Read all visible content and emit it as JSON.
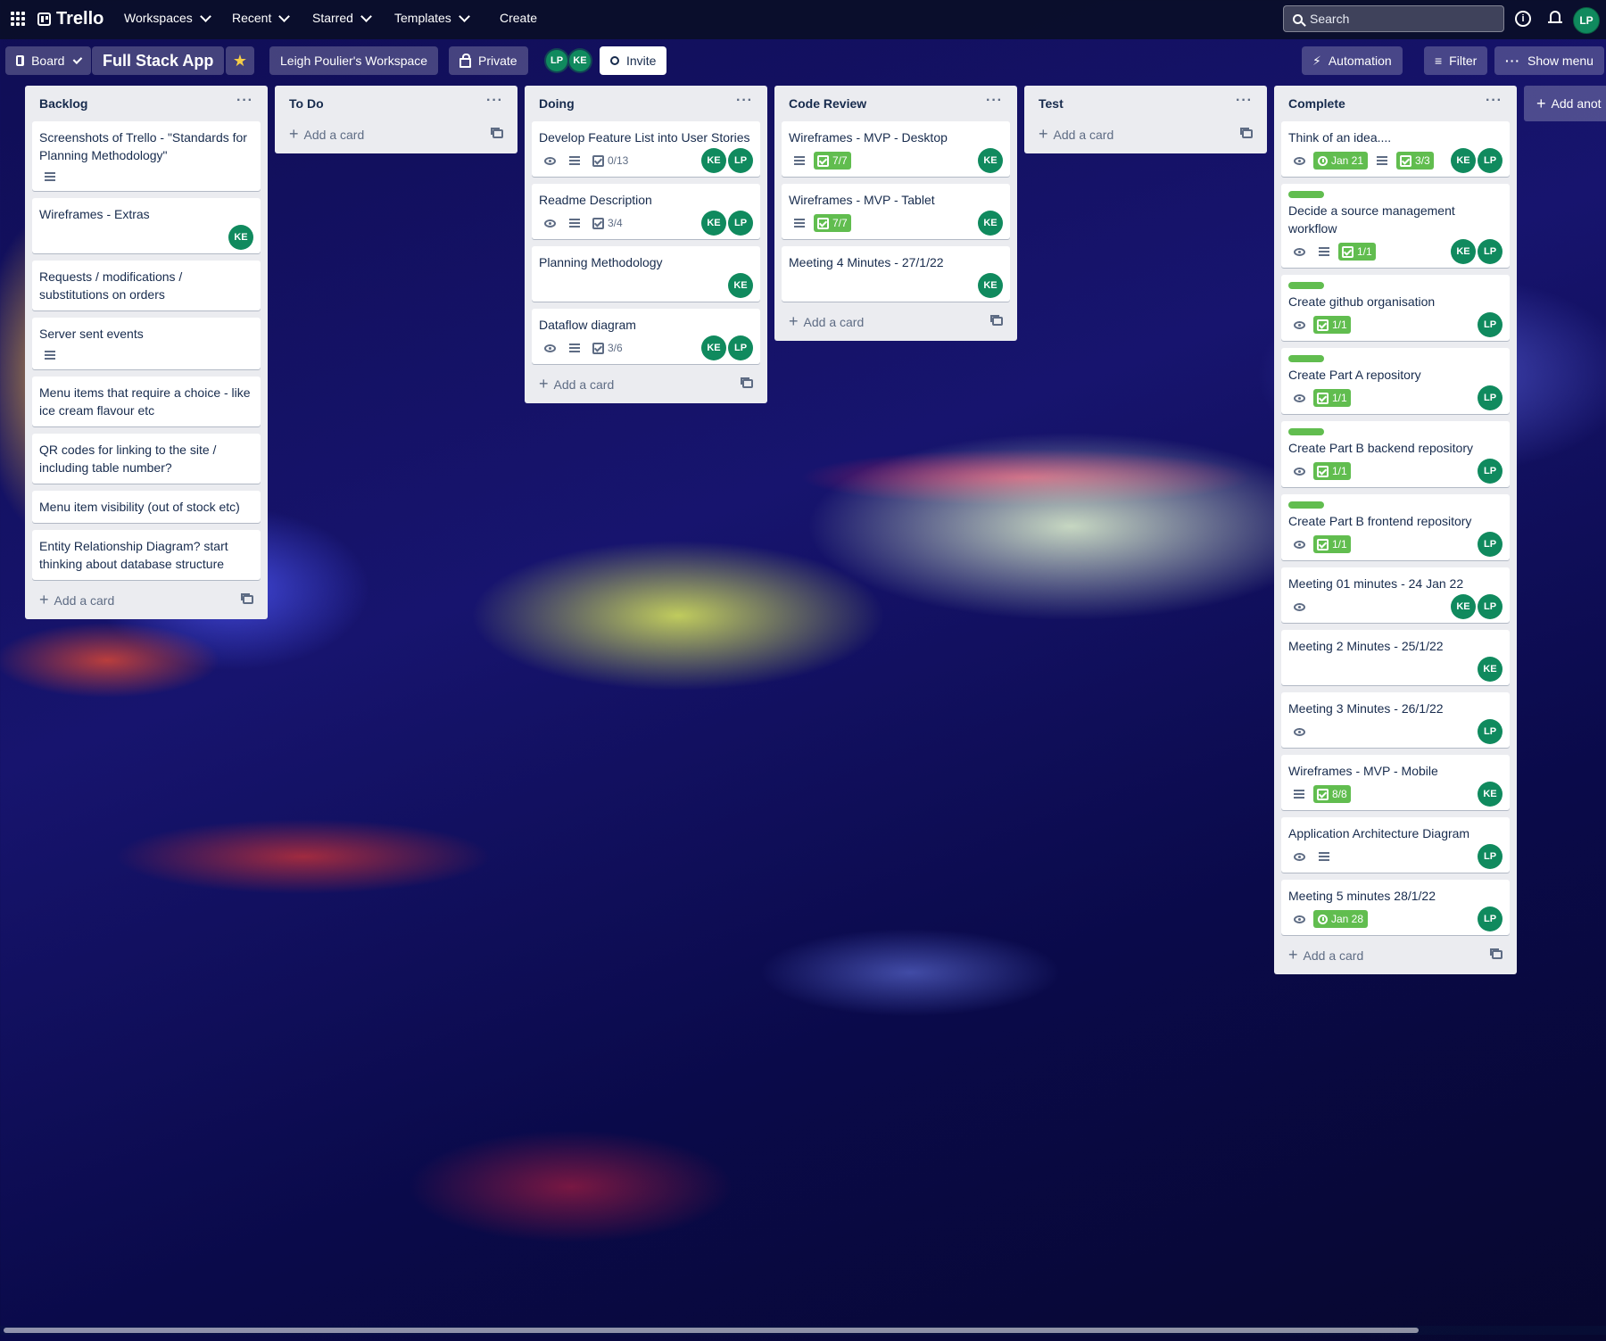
{
  "topbar": {
    "app_name": "Trello",
    "nav": [
      "Workspaces",
      "Recent",
      "Starred",
      "Templates"
    ],
    "create": "Create",
    "search_placeholder": "Search",
    "user_initials": "LP"
  },
  "boardbar": {
    "view": "Board",
    "title": "Full Stack App",
    "workspace": "Leigh Poulier's Workspace",
    "visibility": "Private",
    "members": [
      "LP",
      "KE"
    ],
    "invite": "Invite",
    "automation": "Automation",
    "filter": "Filter",
    "show_menu": "Show menu",
    "add_list": "Add anot"
  },
  "colors": {
    "member_avatar": "#108a5e",
    "label_green": "#61bd4f",
    "list_bg": "#ebecf0",
    "star": "#f5cd47"
  },
  "add_card_label": "Add a card",
  "lists": [
    {
      "title": "Backlog",
      "cards": [
        {
          "title": "Screenshots of Trello - \"Standards for Planning Methodology\"",
          "desc": true
        },
        {
          "title": "Wireframes - Extras",
          "members": [
            "KE"
          ]
        },
        {
          "title": "Requests / modifications / substitutions on orders"
        },
        {
          "title": "Server sent events",
          "desc": true
        },
        {
          "title": "Menu items that require a choice - like ice cream flavour etc"
        },
        {
          "title": "QR codes for linking to the site / including table number?"
        },
        {
          "title": "Menu item visibility (out of stock etc)"
        },
        {
          "title": "Entity Relationship Diagram? start thinking about database structure"
        }
      ]
    },
    {
      "title": "To Do",
      "cards": []
    },
    {
      "title": "Doing",
      "cards": [
        {
          "title": "Develop Feature List into User Stories",
          "watch": true,
          "desc": true,
          "checklist": "0/13",
          "members": [
            "KE",
            "LP"
          ]
        },
        {
          "title": "Readme Description",
          "watch": true,
          "desc": true,
          "checklist": "3/4",
          "members": [
            "KE",
            "LP"
          ]
        },
        {
          "title": "Planning Methodology",
          "members": [
            "KE"
          ]
        },
        {
          "title": "Dataflow diagram",
          "watch": true,
          "desc": true,
          "checklist": "3/6",
          "members": [
            "KE",
            "LP"
          ]
        }
      ]
    },
    {
      "title": "Code Review",
      "cards": [
        {
          "title": "Wireframes - MVP - Desktop",
          "desc": true,
          "checklist": "7/7",
          "checklist_done": true,
          "members": [
            "KE"
          ]
        },
        {
          "title": "Wireframes - MVP - Tablet",
          "desc": true,
          "checklist": "7/7",
          "checklist_done": true,
          "members": [
            "KE"
          ]
        },
        {
          "title": "Meeting 4 Minutes - 27/1/22",
          "members": [
            "KE"
          ]
        }
      ]
    },
    {
      "title": "Test",
      "cards": []
    },
    {
      "title": "Complete",
      "cards": [
        {
          "title": "Think of an idea....",
          "watch": true,
          "due": "Jan 21",
          "desc": true,
          "checklist": "3/3",
          "checklist_done": true,
          "members": [
            "KE",
            "LP"
          ]
        },
        {
          "title": "Decide a source management workflow",
          "label": true,
          "watch": true,
          "desc": true,
          "checklist": "1/1",
          "checklist_done": true,
          "members": [
            "KE",
            "LP"
          ]
        },
        {
          "title": "Create github organisation",
          "label": true,
          "watch": true,
          "checklist": "1/1",
          "checklist_done": true,
          "members": [
            "LP"
          ]
        },
        {
          "title": "Create Part A repository",
          "label": true,
          "watch": true,
          "checklist": "1/1",
          "checklist_done": true,
          "members": [
            "LP"
          ]
        },
        {
          "title": "Create Part B backend repository",
          "label": true,
          "watch": true,
          "checklist": "1/1",
          "checklist_done": true,
          "members": [
            "LP"
          ]
        },
        {
          "title": "Create Part B frontend repository",
          "label": true,
          "watch": true,
          "checklist": "1/1",
          "checklist_done": true,
          "members": [
            "LP"
          ]
        },
        {
          "title": "Meeting 01 minutes - 24 Jan 22",
          "watch": true,
          "members": [
            "KE",
            "LP"
          ]
        },
        {
          "title": "Meeting 2 Minutes - 25/1/22",
          "members": [
            "KE"
          ]
        },
        {
          "title": "Meeting 3 Minutes - 26/1/22",
          "watch": true,
          "members": [
            "LP"
          ]
        },
        {
          "title": "Wireframes - MVP - Mobile",
          "desc": true,
          "checklist": "8/8",
          "checklist_done": true,
          "members": [
            "KE"
          ]
        },
        {
          "title": "Application Architecture Diagram",
          "watch": true,
          "desc": true,
          "members": [
            "LP"
          ]
        },
        {
          "title": "Meeting 5 minutes 28/1/22",
          "watch": true,
          "due": "Jan 28",
          "members": [
            "LP"
          ]
        }
      ]
    }
  ]
}
